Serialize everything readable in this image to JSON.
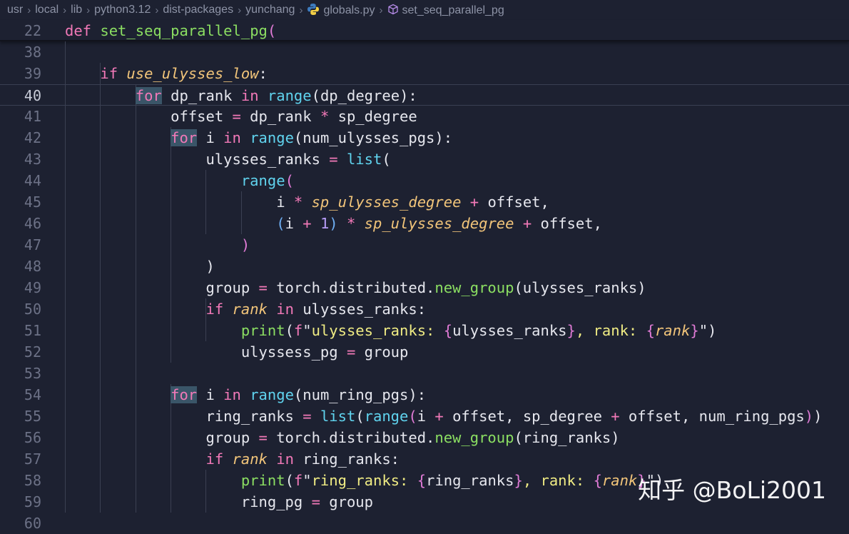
{
  "breadcrumb": {
    "items": [
      "usr",
      "local",
      "lib",
      "python3.12",
      "dist-packages",
      "yunchang"
    ],
    "file": "globals.py",
    "symbol": "set_seq_parallel_pg"
  },
  "sticky": {
    "line_number": "22",
    "tokens": [
      {
        "t": "def",
        "c": "k"
      },
      {
        "t": " ",
        "c": ""
      },
      {
        "t": "set_seq_parallel_pg",
        "c": "fn"
      },
      {
        "t": "(",
        "c": "bp"
      }
    ]
  },
  "editor": {
    "active_line": "40",
    "lines": [
      {
        "n": "38",
        "tokens": []
      },
      {
        "n": "39",
        "tokens": [
          {
            "t": "    ",
            "c": ""
          },
          {
            "t": "if",
            "c": "k"
          },
          {
            "t": " ",
            "c": ""
          },
          {
            "t": "use_ulysses_low",
            "c": "p"
          },
          {
            "t": ":",
            "c": ""
          }
        ]
      },
      {
        "n": "40",
        "tokens": [
          {
            "t": "        ",
            "c": ""
          },
          {
            "t": "for",
            "c": "k hl"
          },
          {
            "t": " dp_rank ",
            "c": ""
          },
          {
            "t": "in",
            "c": "k"
          },
          {
            "t": " ",
            "c": ""
          },
          {
            "t": "range",
            "c": "f"
          },
          {
            "t": "(",
            "c": ""
          },
          {
            "t": "dp_degree",
            "c": ""
          },
          {
            "t": "):",
            "c": ""
          }
        ]
      },
      {
        "n": "41",
        "tokens": [
          {
            "t": "            offset ",
            "c": ""
          },
          {
            "t": "=",
            "c": "o"
          },
          {
            "t": " dp_rank ",
            "c": ""
          },
          {
            "t": "*",
            "c": "o"
          },
          {
            "t": " sp_degree",
            "c": ""
          }
        ]
      },
      {
        "n": "42",
        "tokens": [
          {
            "t": "            ",
            "c": ""
          },
          {
            "t": "for",
            "c": "k hl"
          },
          {
            "t": " i ",
            "c": ""
          },
          {
            "t": "in",
            "c": "k"
          },
          {
            "t": " ",
            "c": ""
          },
          {
            "t": "range",
            "c": "f"
          },
          {
            "t": "(num_ulysses_pgs):",
            "c": ""
          }
        ]
      },
      {
        "n": "43",
        "tokens": [
          {
            "t": "                ulysses_ranks ",
            "c": ""
          },
          {
            "t": "=",
            "c": "o"
          },
          {
            "t": " ",
            "c": ""
          },
          {
            "t": "list",
            "c": "f"
          },
          {
            "t": "(",
            "c": ""
          }
        ]
      },
      {
        "n": "44",
        "tokens": [
          {
            "t": "                    ",
            "c": ""
          },
          {
            "t": "range",
            "c": "f"
          },
          {
            "t": "(",
            "c": "bp"
          }
        ]
      },
      {
        "n": "45",
        "tokens": [
          {
            "t": "                        i ",
            "c": ""
          },
          {
            "t": "*",
            "c": "o"
          },
          {
            "t": " ",
            "c": ""
          },
          {
            "t": "sp_ulysses_degree",
            "c": "p"
          },
          {
            "t": " ",
            "c": ""
          },
          {
            "t": "+",
            "c": "o"
          },
          {
            "t": " offset,",
            "c": ""
          }
        ]
      },
      {
        "n": "46",
        "tokens": [
          {
            "t": "                        ",
            "c": ""
          },
          {
            "t": "(",
            "c": "bb"
          },
          {
            "t": "i ",
            "c": ""
          },
          {
            "t": "+",
            "c": "o"
          },
          {
            "t": " ",
            "c": ""
          },
          {
            "t": "1",
            "c": "n"
          },
          {
            "t": ")",
            "c": "bb"
          },
          {
            "t": " ",
            "c": ""
          },
          {
            "t": "*",
            "c": "o"
          },
          {
            "t": " ",
            "c": ""
          },
          {
            "t": "sp_ulysses_degree",
            "c": "p"
          },
          {
            "t": " ",
            "c": ""
          },
          {
            "t": "+",
            "c": "o"
          },
          {
            "t": " offset,",
            "c": ""
          }
        ]
      },
      {
        "n": "47",
        "tokens": [
          {
            "t": "                    ",
            "c": ""
          },
          {
            "t": ")",
            "c": "bp"
          }
        ]
      },
      {
        "n": "48",
        "tokens": [
          {
            "t": "                )",
            "c": ""
          }
        ]
      },
      {
        "n": "49",
        "tokens": [
          {
            "t": "                group ",
            "c": ""
          },
          {
            "t": "=",
            "c": "o"
          },
          {
            "t": " torch.distributed.",
            "c": ""
          },
          {
            "t": "new_group",
            "c": "fn"
          },
          {
            "t": "(ulysses_ranks)",
            "c": ""
          }
        ]
      },
      {
        "n": "50",
        "tokens": [
          {
            "t": "                ",
            "c": ""
          },
          {
            "t": "if",
            "c": "k"
          },
          {
            "t": " ",
            "c": ""
          },
          {
            "t": "rank",
            "c": "p"
          },
          {
            "t": " ",
            "c": ""
          },
          {
            "t": "in",
            "c": "k"
          },
          {
            "t": " ulysses_ranks:",
            "c": ""
          }
        ]
      },
      {
        "n": "51",
        "tokens": [
          {
            "t": "                    ",
            "c": ""
          },
          {
            "t": "print",
            "c": "fn"
          },
          {
            "t": "(",
            "c": ""
          },
          {
            "t": "f",
            "c": "k"
          },
          {
            "t": "\"",
            "c": ""
          },
          {
            "t": "ulysses_ranks: ",
            "c": "s"
          },
          {
            "t": "{",
            "c": "bp"
          },
          {
            "t": "ulysses_ranks",
            "c": ""
          },
          {
            "t": "}",
            "c": "bp"
          },
          {
            "t": ", rank: ",
            "c": "s"
          },
          {
            "t": "{",
            "c": "bp"
          },
          {
            "t": "rank",
            "c": "p"
          },
          {
            "t": "}",
            "c": "bp"
          },
          {
            "t": "\")",
            "c": ""
          }
        ]
      },
      {
        "n": "52",
        "tokens": [
          {
            "t": "                    ulyssess_pg ",
            "c": ""
          },
          {
            "t": "=",
            "c": "o"
          },
          {
            "t": " group",
            "c": ""
          }
        ]
      },
      {
        "n": "53",
        "tokens": []
      },
      {
        "n": "54",
        "tokens": [
          {
            "t": "            ",
            "c": ""
          },
          {
            "t": "for",
            "c": "k hl"
          },
          {
            "t": " i ",
            "c": ""
          },
          {
            "t": "in",
            "c": "k"
          },
          {
            "t": " ",
            "c": ""
          },
          {
            "t": "range",
            "c": "f"
          },
          {
            "t": "(num_ring_pgs):",
            "c": ""
          }
        ]
      },
      {
        "n": "55",
        "tokens": [
          {
            "t": "                ring_ranks ",
            "c": ""
          },
          {
            "t": "=",
            "c": "o"
          },
          {
            "t": " ",
            "c": ""
          },
          {
            "t": "list",
            "c": "f"
          },
          {
            "t": "(",
            "c": ""
          },
          {
            "t": "range",
            "c": "f"
          },
          {
            "t": "(",
            "c": "bp"
          },
          {
            "t": "i ",
            "c": ""
          },
          {
            "t": "+",
            "c": "o"
          },
          {
            "t": " offset, sp_degree ",
            "c": ""
          },
          {
            "t": "+",
            "c": "o"
          },
          {
            "t": " offset, num_ring_pgs",
            "c": ""
          },
          {
            "t": ")",
            "c": "bp"
          },
          {
            "t": ")",
            "c": ""
          }
        ]
      },
      {
        "n": "56",
        "tokens": [
          {
            "t": "                group ",
            "c": ""
          },
          {
            "t": "=",
            "c": "o"
          },
          {
            "t": " torch.distributed.",
            "c": ""
          },
          {
            "t": "new_group",
            "c": "fn"
          },
          {
            "t": "(ring_ranks)",
            "c": ""
          }
        ]
      },
      {
        "n": "57",
        "tokens": [
          {
            "t": "                ",
            "c": ""
          },
          {
            "t": "if",
            "c": "k"
          },
          {
            "t": " ",
            "c": ""
          },
          {
            "t": "rank",
            "c": "p"
          },
          {
            "t": " ",
            "c": ""
          },
          {
            "t": "in",
            "c": "k"
          },
          {
            "t": " ring_ranks:",
            "c": ""
          }
        ]
      },
      {
        "n": "58",
        "tokens": [
          {
            "t": "                    ",
            "c": ""
          },
          {
            "t": "print",
            "c": "fn"
          },
          {
            "t": "(",
            "c": ""
          },
          {
            "t": "f",
            "c": "k"
          },
          {
            "t": "\"",
            "c": ""
          },
          {
            "t": "ring_ranks: ",
            "c": "s"
          },
          {
            "t": "{",
            "c": "bp"
          },
          {
            "t": "ring_ranks",
            "c": ""
          },
          {
            "t": "}",
            "c": "bp"
          },
          {
            "t": ", rank: ",
            "c": "s"
          },
          {
            "t": "{",
            "c": "bp"
          },
          {
            "t": "rank",
            "c": "p"
          },
          {
            "t": "}",
            "c": "bp"
          },
          {
            "t": "\")",
            "c": ""
          }
        ]
      },
      {
        "n": "59",
        "tokens": [
          {
            "t": "                    ring_pg ",
            "c": ""
          },
          {
            "t": "=",
            "c": "o"
          },
          {
            "t": " group",
            "c": ""
          }
        ]
      },
      {
        "n": "60",
        "tokens": []
      }
    ]
  },
  "watermark": "知乎 @BoLi2001",
  "colors": {
    "background": "#1d2131",
    "keyword": "#f279b8",
    "builtin": "#60d3ee",
    "function": "#8bde62",
    "parameter": "#f2c57a",
    "string": "#f0ec84",
    "number": "#b69cf6"
  }
}
